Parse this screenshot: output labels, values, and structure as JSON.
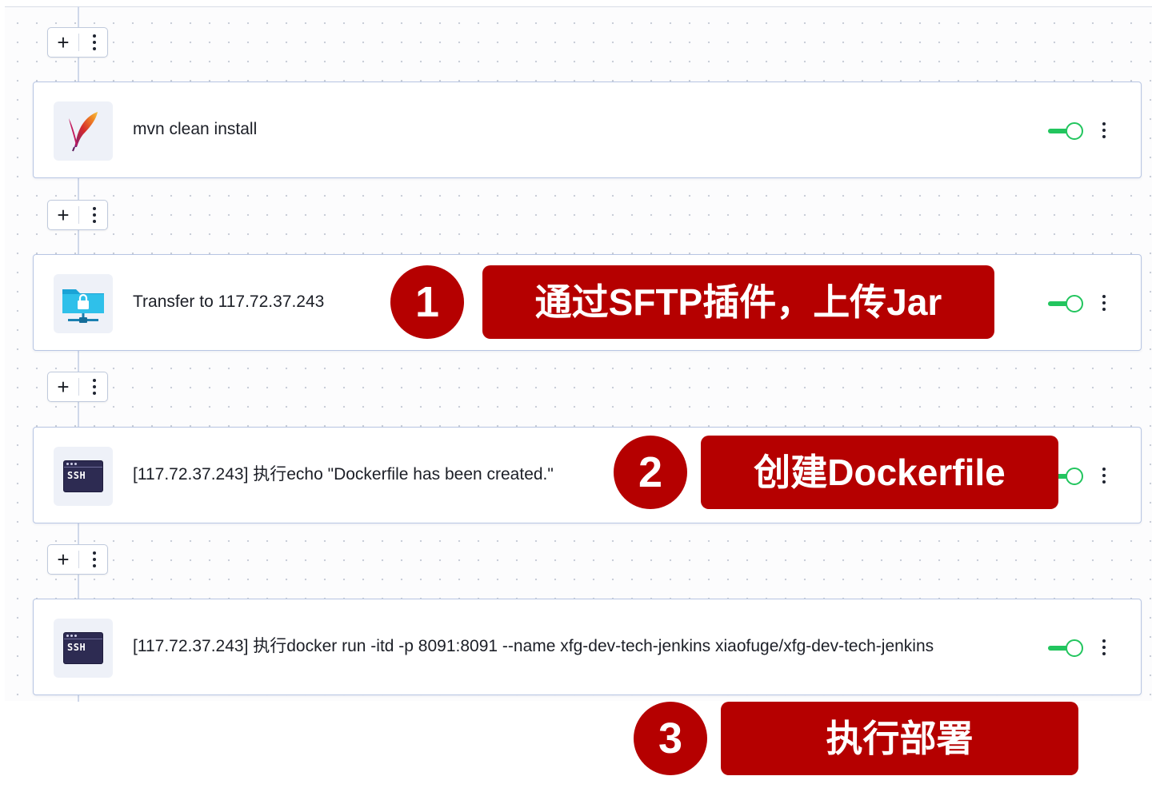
{
  "pipeline": {
    "add_symbol": "+",
    "steps": [
      {
        "icon": "apache-feather-icon",
        "label": "mvn clean install",
        "enabled": true
      },
      {
        "icon": "sftp-folder-lock-icon",
        "label": "Transfer to 117.72.37.243",
        "enabled": true
      },
      {
        "icon": "ssh-terminal-icon",
        "icon_text": "SSH",
        "label": "[117.72.37.243] 执行echo \"Dockerfile has been created.\"",
        "enabled": true
      },
      {
        "icon": "ssh-terminal-icon",
        "icon_text": "SSH",
        "label": "[117.72.37.243] 执行docker run -itd -p 8091:8091 --name xfg-dev-tech-jenkins xiaofuge/xfg-dev-tech-jenkins",
        "enabled": true
      }
    ]
  },
  "annotations": [
    {
      "number": "1",
      "text": "通过SFTP插件，上传Jar"
    },
    {
      "number": "2",
      "text": "创建Dockerfile"
    },
    {
      "number": "3",
      "text": "执行部署"
    }
  ],
  "colors": {
    "toggle_on": "#22c55e",
    "annotation_red": "#b50000",
    "card_border": "#b8c6e3"
  }
}
